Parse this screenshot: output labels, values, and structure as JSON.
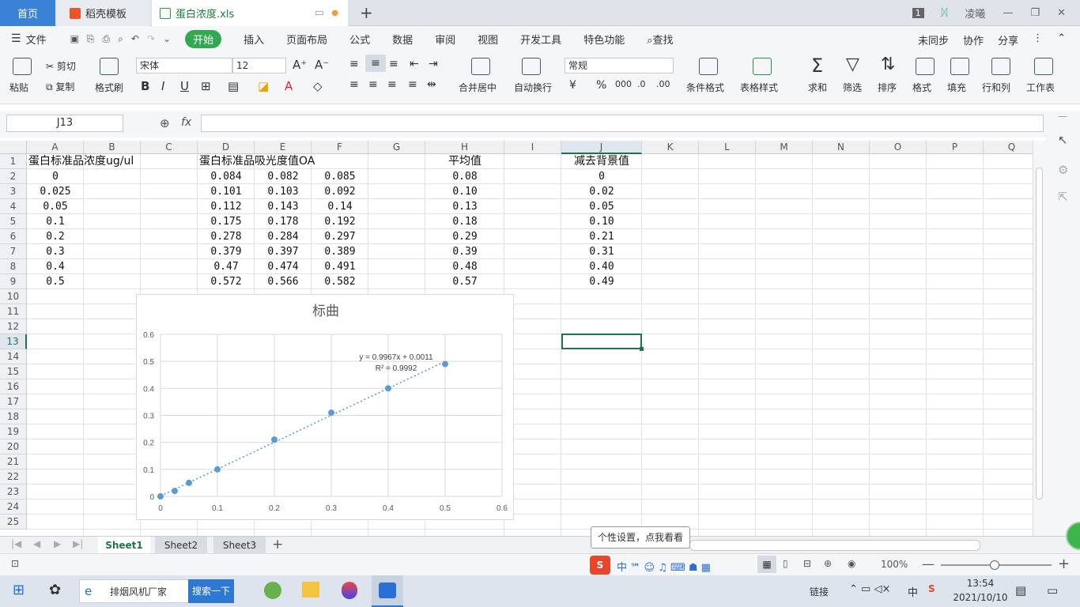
{
  "tabs": {
    "home": "首页",
    "template": "稻壳模板",
    "file": "蛋白浓度.xls"
  },
  "window": {
    "badge": "1",
    "user": "凌曦"
  },
  "menu": [
    "文件",
    "开始",
    "插入",
    "页面布局",
    "公式",
    "数据",
    "审阅",
    "视图",
    "开发工具",
    "特色功能",
    "查找"
  ],
  "menu_right": {
    "sync": "未同步",
    "collab": "协作",
    "share": "分享"
  },
  "ribbon": {
    "paste": "粘贴",
    "cut": "剪切",
    "copy": "复制",
    "format_painter": "格式刷",
    "font": "宋体",
    "size": "12",
    "merge": "合并居中",
    "wrap": "自动换行",
    "number_format": "常规",
    "cond_format": "条件格式",
    "table_style": "表格样式",
    "sum": "求和",
    "filter": "筛选",
    "sort": "排序",
    "format": "格式",
    "fill": "填充",
    "rowcol": "行和列",
    "worksheet": "工作表"
  },
  "namebox": "J13",
  "fx": "fx",
  "columns": [
    "A",
    "B",
    "C",
    "D",
    "E",
    "F",
    "G",
    "H",
    "I",
    "J",
    "K",
    "L",
    "M",
    "N",
    "O",
    "P",
    "Q"
  ],
  "rows": [
    "1",
    "2",
    "3",
    "4",
    "5",
    "6",
    "7",
    "8",
    "9",
    "10",
    "11",
    "12",
    "13",
    "14",
    "15",
    "16",
    "17",
    "18",
    "19",
    "20",
    "21",
    "22",
    "23",
    "24",
    "25"
  ],
  "headers": {
    "a1": "蛋白标准品浓度ug/ul",
    "d1": "蛋白标准品吸光度值OA",
    "h1": "平均值",
    "j1": "减去背景值"
  },
  "table": [
    [
      "0",
      "0.084",
      "0.082",
      "0.085",
      "0.08",
      "0"
    ],
    [
      "0.025",
      "0.101",
      "0.103",
      "0.092",
      "0.10",
      "0.02"
    ],
    [
      "0.05",
      "0.112",
      "0.143",
      "0.14",
      "0.13",
      "0.05"
    ],
    [
      "0.1",
      "0.175",
      "0.178",
      "0.192",
      "0.18",
      "0.10"
    ],
    [
      "0.2",
      "0.278",
      "0.284",
      "0.297",
      "0.29",
      "0.21"
    ],
    [
      "0.3",
      "0.379",
      "0.397",
      "0.389",
      "0.39",
      "0.31"
    ],
    [
      "0.4",
      "0.47",
      "0.474",
      "0.491",
      "0.48",
      "0.40"
    ],
    [
      "0.5",
      "0.572",
      "0.566",
      "0.582",
      "0.57",
      "0.49"
    ]
  ],
  "chart_data": {
    "type": "scatter",
    "title": "标曲",
    "x": [
      0,
      0.025,
      0.05,
      0.1,
      0.2,
      0.3,
      0.4,
      0.5
    ],
    "y": [
      0,
      0.02,
      0.05,
      0.1,
      0.21,
      0.31,
      0.4,
      0.49
    ],
    "xlim": [
      0,
      0.6
    ],
    "ylim": [
      0,
      0.6
    ],
    "xticks": [
      "0",
      "0.1",
      "0.2",
      "0.3",
      "0.4",
      "0.5",
      "0.6"
    ],
    "yticks": [
      "0",
      "0.1",
      "0.2",
      "0.3",
      "0.4",
      "0.5",
      "0.6"
    ],
    "trendline": {
      "slope": 0.9967,
      "intercept": 0.0011,
      "equation": "y = 0.9967x + 0.0011",
      "r2": "R² = 0.9992"
    },
    "grid": true,
    "color": "#5b9bd5"
  },
  "sheets": [
    "Sheet1",
    "Sheet2",
    "Sheet3"
  ],
  "tooltip": "个性设置，点我看看",
  "zoom": "100%",
  "taskbar": {
    "search_text": "排烟风机厂家",
    "search_btn": "搜索一下",
    "link": "链接",
    "ime": "中",
    "time": "13:54",
    "date": "2021/10/10"
  }
}
